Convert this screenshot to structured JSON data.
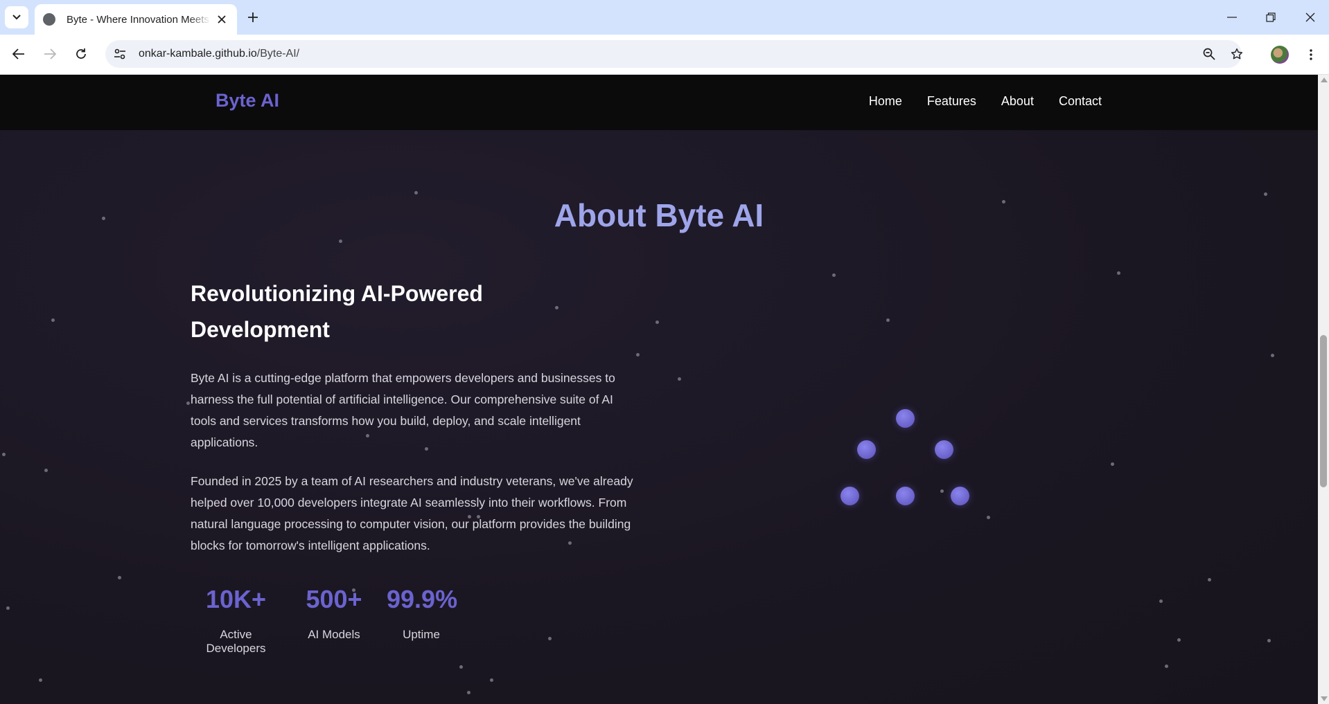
{
  "browser": {
    "tab_title": "Byte - Where Innovation Meets",
    "url_host": "onkar-kambale.github.io",
    "url_path": "/Byte-AI/"
  },
  "nav": {
    "brand": "Byte AI",
    "links": [
      "Home",
      "Features",
      "About",
      "Contact"
    ]
  },
  "about": {
    "title": "About Byte AI",
    "subtitle": "Revolutionizing AI-Powered Development",
    "paragraphs": [
      "Byte AI is a cutting-edge platform that empowers developers and businesses to harness the full potential of artificial intelligence. Our comprehensive suite of AI tools and services transforms how you build, deploy, and scale intelligent applications.",
      "Founded in 2025 by a team of AI researchers and industry veterans, we've already helped over 10,000 developers integrate AI seamlessly into their workflows. From natural language processing to computer vision, our platform provides the building blocks for tomorrow's intelligent applications."
    ],
    "stats": [
      {
        "value": "10K+",
        "label": "Active Developers"
      },
      {
        "value": "500+",
        "label": "AI Models"
      },
      {
        "value": "99.9%",
        "label": "Uptime"
      }
    ]
  },
  "colors": {
    "accent": "#6b63cf",
    "title": "#9ea5ea",
    "background": "#1a1622",
    "navbar": "#0b0b0c"
  }
}
